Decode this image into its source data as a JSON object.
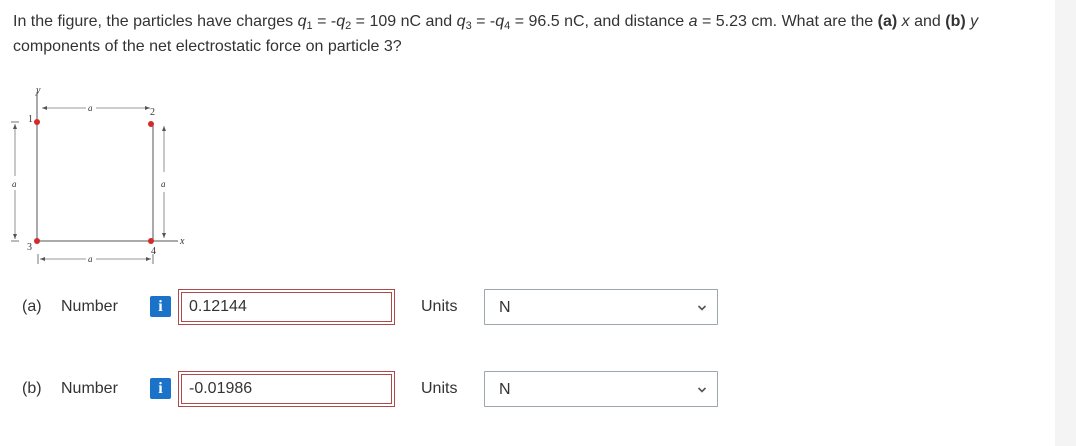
{
  "question": {
    "t1": "In the figure, the particles have charges ",
    "q1": "q",
    "q1sub": "1",
    "t2": " = -",
    "q2": "q",
    "q2sub": "2",
    "t3": " = 109 nC and ",
    "q3": "q",
    "q3sub": "3",
    "t4": " = -",
    "q4": "q",
    "q4sub": "4",
    "t5": " = 96.5 nC, and distance ",
    "avar": "a",
    "t6": " = 5.23 cm. What are the ",
    "parta": "(a)",
    "t7": " ",
    "xvar": "x",
    "t8": " and ",
    "partb": "(b)",
    "t9": " ",
    "yvar": "y",
    "t10": " components of the net electrostatic force on particle 3?"
  },
  "figure": {
    "y_axis": "y",
    "x_axis": "x",
    "a_top": "a",
    "a_right": "a",
    "a_left": "a",
    "a_bottom": "a",
    "p1": "1",
    "p2": "2",
    "p3": "3",
    "p4": "4"
  },
  "answers": [
    {
      "part": "(a)",
      "number_label": "Number",
      "info": "i",
      "value": "0.12144",
      "units_label": "Units",
      "unit": "N"
    },
    {
      "part": "(b)",
      "number_label": "Number",
      "info": "i",
      "value": "-0.01986",
      "units_label": "Units",
      "unit": "N"
    }
  ],
  "colors": {
    "charge_dot": "#d42a2a",
    "info_icon": "#1a73c9",
    "input_border": "#b04a4a",
    "select_border": "#9ca6ad"
  }
}
